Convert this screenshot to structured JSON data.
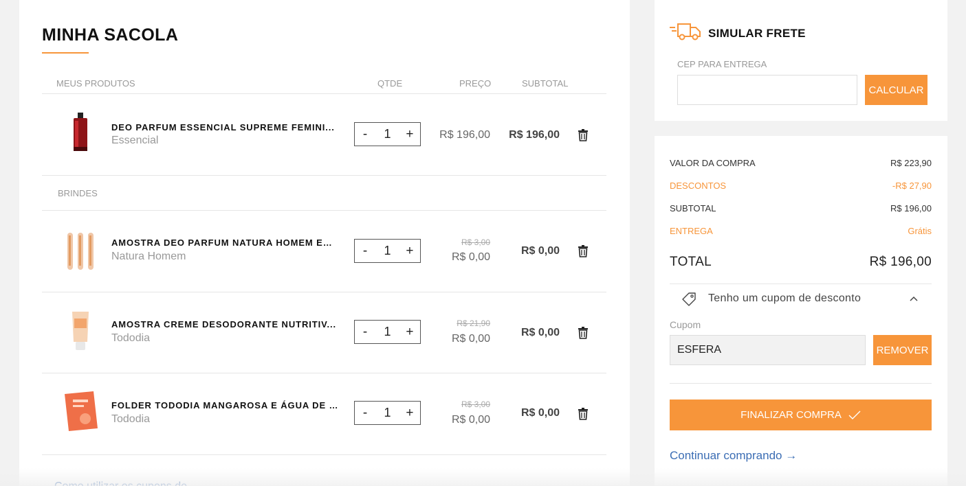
{
  "bag": {
    "title": "MINHA SACOLA",
    "columns": {
      "products": "MEUS PRODUTOS",
      "qty": "QTDE",
      "price": "PREÇO",
      "subtotal": "SUBTOTAL"
    },
    "gifts_label": "BRINDES",
    "items": [
      {
        "name": "DEO PARFUM ESSENCIAL SUPREME FEMINI...",
        "brand": "Essencial",
        "qty": "1",
        "old_price": "",
        "price": "R$ 196,00",
        "subtotal": "R$ 196,00"
      },
      {
        "name": "AMOSTRA DEO PARFUM NATURA HOMEM ES...",
        "brand": "Natura Homem",
        "qty": "1",
        "old_price": "R$ 3,00",
        "price": "R$ 0,00",
        "subtotal": "R$ 0,00"
      },
      {
        "name": "AMOSTRA CREME DESODORANTE NUTRITIV...",
        "brand": "Tododia",
        "qty": "1",
        "old_price": "R$ 21,90",
        "price": "R$ 0,00",
        "subtotal": "R$ 0,00"
      },
      {
        "name": "FOLDER TODODIA MANGAROSA E ÁGUA DE ...",
        "brand": "Tododia",
        "qty": "1",
        "old_price": "R$ 3,00",
        "price": "R$ 0,00",
        "subtotal": "R$ 0,00"
      }
    ],
    "qty_minus": "-",
    "qty_plus": "+",
    "bottom_hint": "Como utilizar os cupons de..."
  },
  "shipping": {
    "title": "SIMULAR FRETE",
    "cep_label": "CEP PARA ENTREGA",
    "cep_value": "",
    "calc_button": "CALCULAR"
  },
  "summary": {
    "purchase_label": "VALOR DA COMPRA",
    "purchase_value": "R$ 223,90",
    "discount_label": "DESCONTOS",
    "discount_value": "-R$ 27,90",
    "subtotal_label": "SUBTOTAL",
    "subtotal_value": "R$ 196,00",
    "delivery_label": "ENTREGA",
    "delivery_value": "Grátis",
    "total_label": "TOTAL",
    "total_value": "R$ 196,00",
    "coupon_toggle": "Tenho um cupom de desconto",
    "coupon_label": "Cupom",
    "coupon_value": "ESFERA",
    "remove_button": "REMOVER",
    "finish_button": "FINALIZAR COMPRA",
    "continue_link": "Continuar comprando →"
  },
  "colors": {
    "accent": "#f7953a",
    "link": "#3b6db4",
    "muted": "#999999"
  },
  "icons": [
    "truck-icon",
    "trash-icon",
    "tag-icon",
    "chevron-up-icon",
    "check-icon",
    "arrow-right-icon"
  ]
}
